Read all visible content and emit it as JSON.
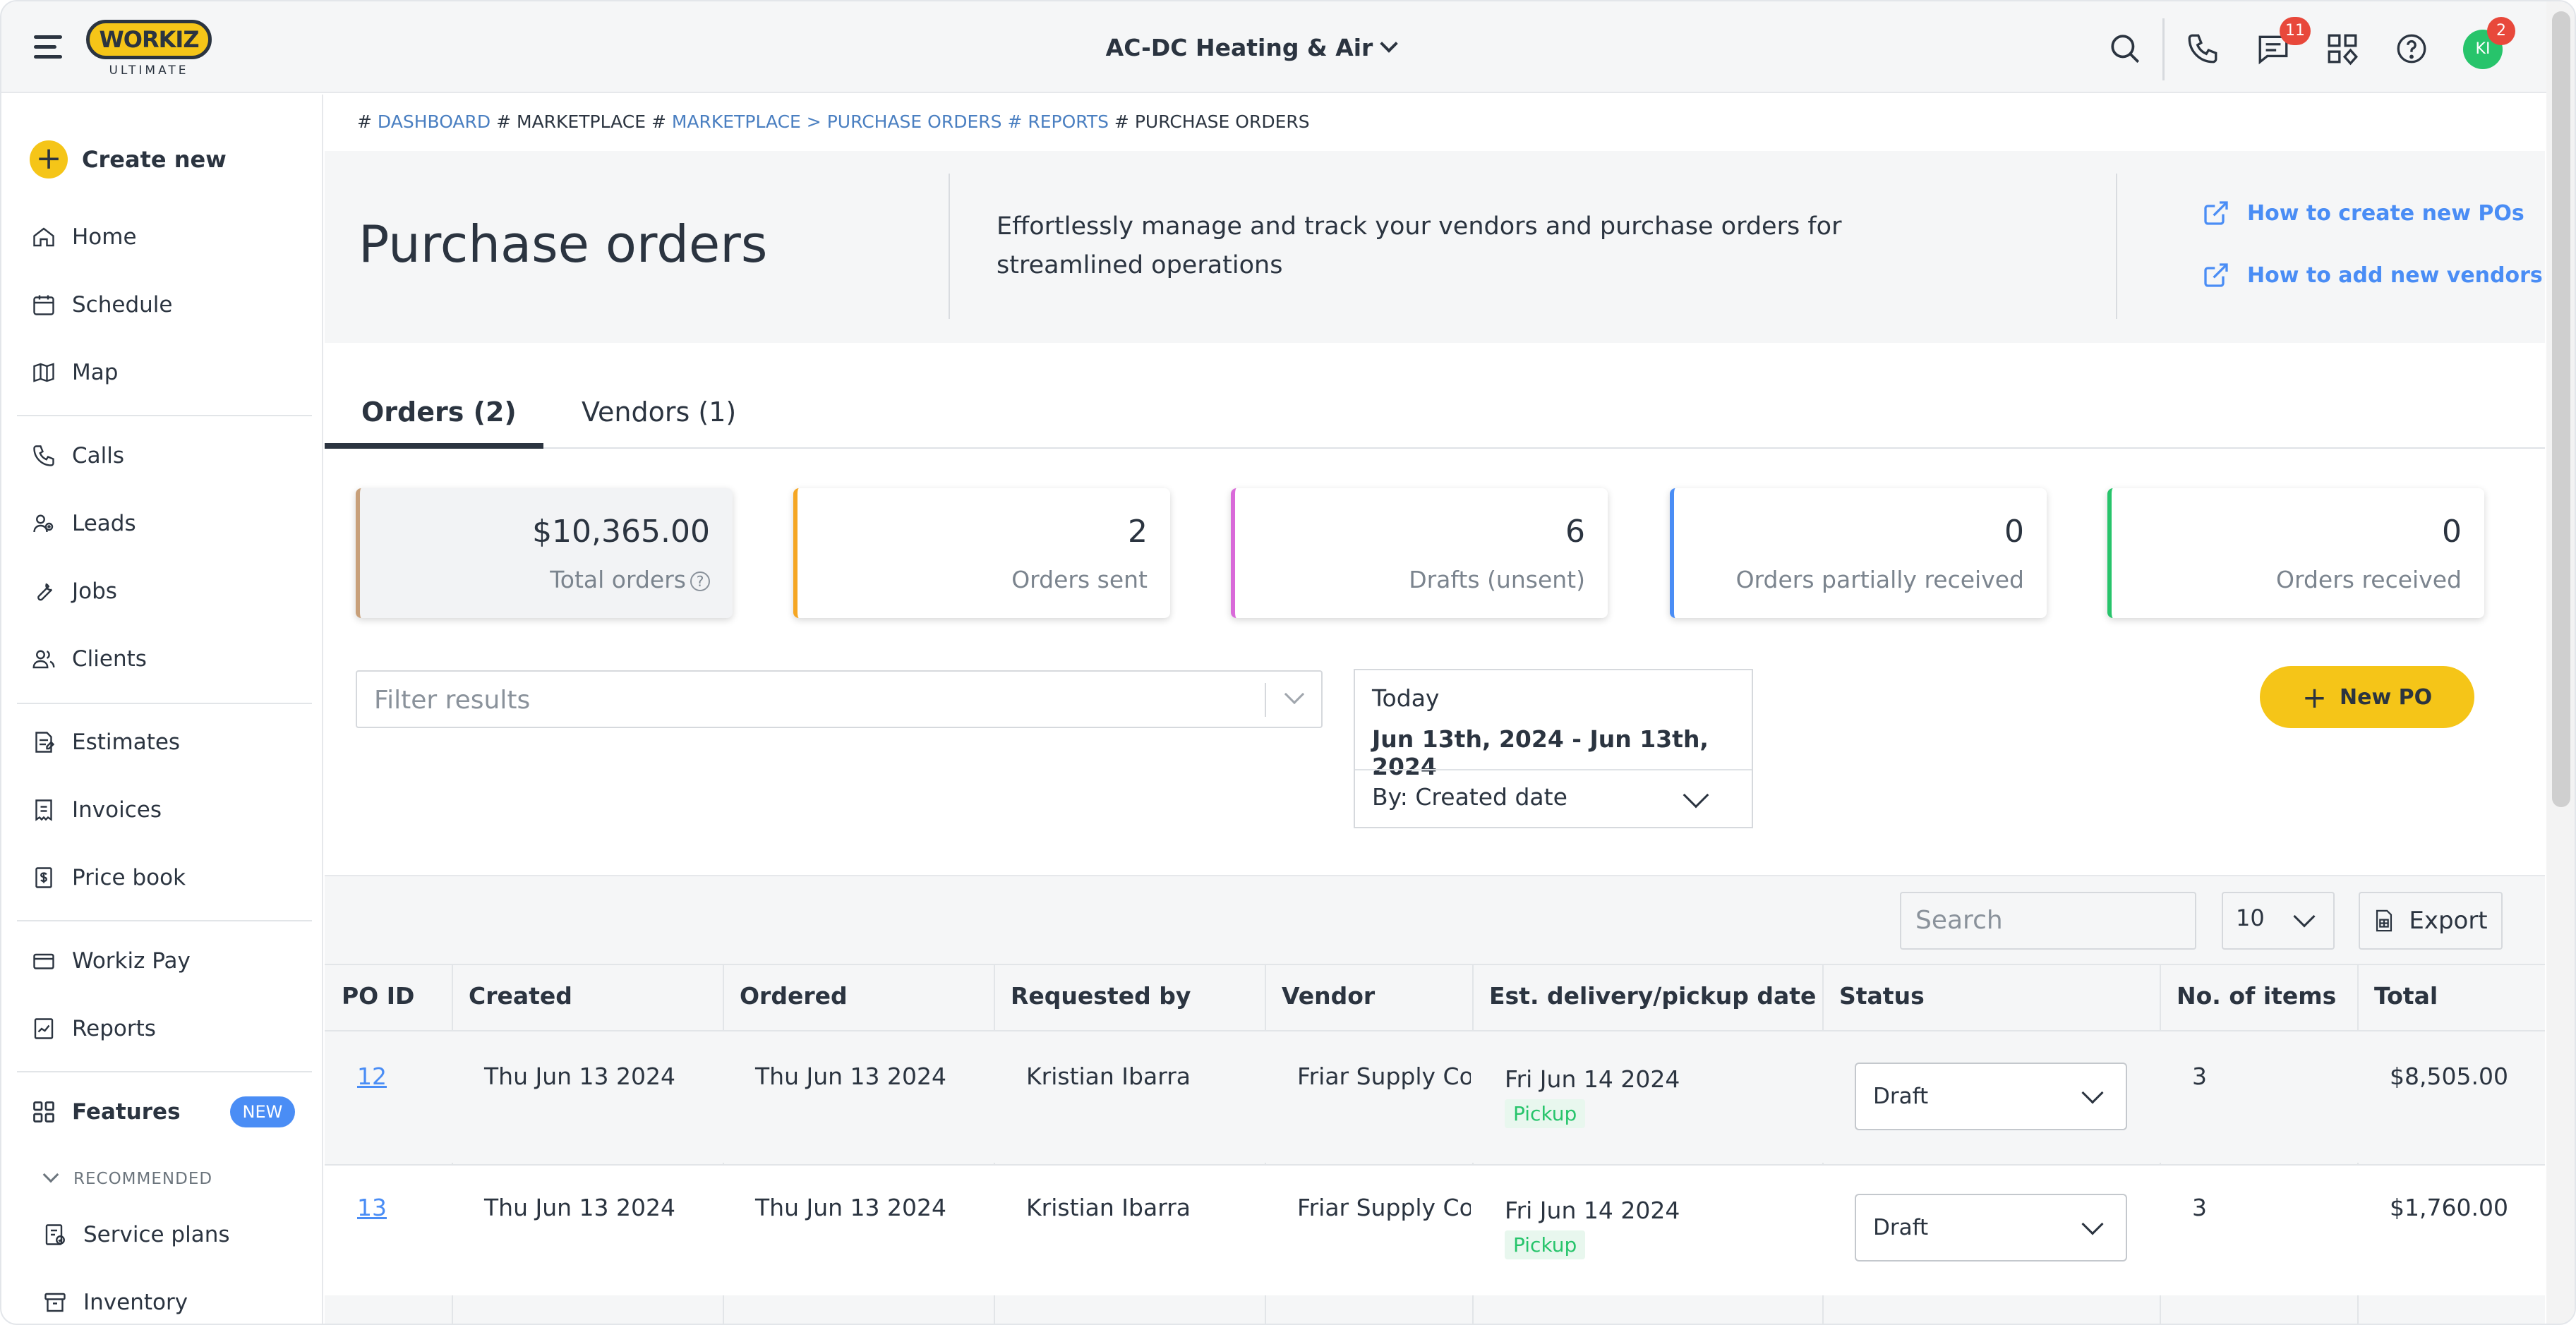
{
  "header": {
    "logo": "WORKIZ",
    "logo_sub": "ULTIMATE",
    "company": "AC-DC Heating & Air",
    "messages_badge": "11",
    "avatar_initials": "KI",
    "avatar_badge": "2"
  },
  "sidebar": {
    "create_new": "Create new",
    "items": [
      {
        "label": "Home",
        "icon": "home-icon"
      },
      {
        "label": "Schedule",
        "icon": "calendar-icon"
      },
      {
        "label": "Map",
        "icon": "map-icon"
      },
      {
        "label": "Calls",
        "icon": "phone-icon"
      },
      {
        "label": "Leads",
        "icon": "leads-icon"
      },
      {
        "label": "Jobs",
        "icon": "wrench-icon"
      },
      {
        "label": "Clients",
        "icon": "clients-icon"
      },
      {
        "label": "Estimates",
        "icon": "estimate-icon"
      },
      {
        "label": "Invoices",
        "icon": "invoice-icon"
      },
      {
        "label": "Price book",
        "icon": "pricebook-icon"
      },
      {
        "label": "Workiz Pay",
        "icon": "card-icon"
      },
      {
        "label": "Reports",
        "icon": "reports-icon"
      }
    ],
    "features": "Features",
    "features_badge": "NEW",
    "recommended": "RECOMMENDED",
    "service_plans": "Service plans",
    "inventory": "Inventory"
  },
  "breadcrumb": {
    "p1": "# ",
    "dashboard": "DASHBOARD",
    "p2": " # MARKETPLACE # ",
    "marketplace": "MARKETPLACE",
    "p3": " > ",
    "purchase_orders": "PURCHASE ORDERS",
    "p4": " # ",
    "reports": "REPORTS",
    "p5": " # PURCHASE ORDERS"
  },
  "hero": {
    "title": "Purchase orders",
    "description": "Effortlessly manage and track your vendors and purchase orders for streamlined operations",
    "link1": "How to create new POs",
    "link2": "How to add new vendors"
  },
  "tabs": {
    "orders": "Orders (2)",
    "vendors": "Vendors (1)"
  },
  "cards": [
    {
      "value": "$10,365.00",
      "label": "Total orders",
      "color": "#c8a07a"
    },
    {
      "value": "2",
      "label": "Orders sent",
      "color": "#f5a623"
    },
    {
      "value": "6",
      "label": "Drafts (unsent)",
      "color": "#d96ad9"
    },
    {
      "value": "0",
      "label": "Orders partially received",
      "color": "#4a8df5"
    },
    {
      "value": "0",
      "label": "Orders received",
      "color": "#27c46b"
    }
  ],
  "filter": {
    "placeholder": "Filter results"
  },
  "date": {
    "preset": "Today",
    "range": "Jun 13th, 2024 - Jun 13th, 2024",
    "by": "By: Created date"
  },
  "new_po": "New PO",
  "toolbar": {
    "search_placeholder": "Search",
    "per_page": "10",
    "export": "Export"
  },
  "table": {
    "headers": [
      "PO ID",
      "Created",
      "Ordered",
      "Requested by",
      "Vendor",
      "Est. delivery/pickup date",
      "Status",
      "No. of items",
      "Total"
    ],
    "rows": [
      {
        "po_id": "12",
        "created": "Thu Jun 13 2024",
        "ordered": "Thu Jun 13 2024",
        "requested_by": "Kristian Ibarra",
        "vendor": "Friar Supply Co",
        "delivery": "Fri Jun 14 2024",
        "delivery_type": "Pickup",
        "status": "Draft",
        "items": "3",
        "total": "$8,505.00"
      },
      {
        "po_id": "13",
        "created": "Thu Jun 13 2024",
        "ordered": "Thu Jun 13 2024",
        "requested_by": "Kristian Ibarra",
        "vendor": "Friar Supply Co",
        "delivery": "Fri Jun 14 2024",
        "delivery_type": "Pickup",
        "status": "Draft",
        "items": "3",
        "total": "$1,760.00"
      }
    ]
  }
}
